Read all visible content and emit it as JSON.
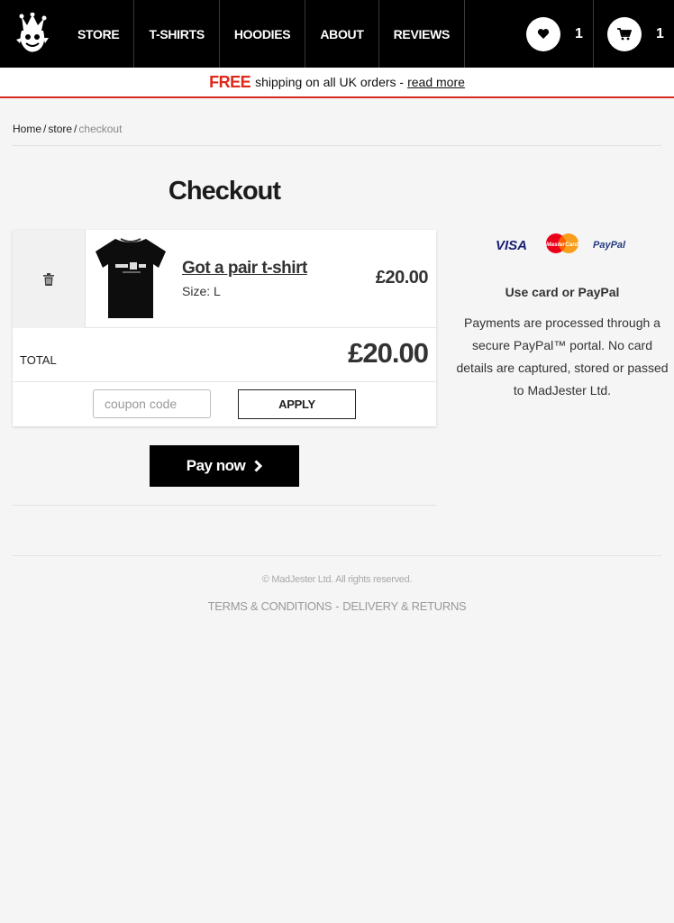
{
  "header": {
    "nav": [
      {
        "label": "STORE"
      },
      {
        "label": "T-SHIRTS"
      },
      {
        "label": "HOODIES"
      },
      {
        "label": "ABOUT"
      },
      {
        "label": "REVIEWS"
      }
    ],
    "wishlist_count": "1",
    "cart_count": "1",
    "icons": {
      "logo": "jester-logo",
      "wishlist": "heart-icon",
      "cart": "cart-icon"
    }
  },
  "banner": {
    "free": "FREE",
    "text": "shipping on all UK orders -",
    "link": "read more"
  },
  "breadcrumb": {
    "home": "Home",
    "store": "store",
    "current": "checkout",
    "sep": "/"
  },
  "page": {
    "title": "Checkout"
  },
  "cart": {
    "item": {
      "name": "Got a pair t-shirt",
      "size": "Size: L",
      "price": "£20.00"
    },
    "total_label": "TOTAL",
    "total_value": "£20.00",
    "coupon_placeholder": "coupon code",
    "apply_label": "APPLY",
    "pay_label": "Pay now"
  },
  "payment": {
    "logos": [
      "VISA",
      "MasterCard",
      "PayPal"
    ],
    "heading": "Use card or PayPal",
    "text": "Payments are processed through a secure PayPal™ portal. No card details are captured, stored or passed to MadJester Ltd."
  },
  "footer": {
    "copyright": "© MadJester Ltd. All rights reserved.",
    "terms": "TERMS & CONDITIONS",
    "dash": "-",
    "delivery": "DELIVERY & RETURNS"
  },
  "colors": {
    "accent": "#e0281a",
    "header_bg": "#000000",
    "page_bg": "#f5f5f5"
  }
}
